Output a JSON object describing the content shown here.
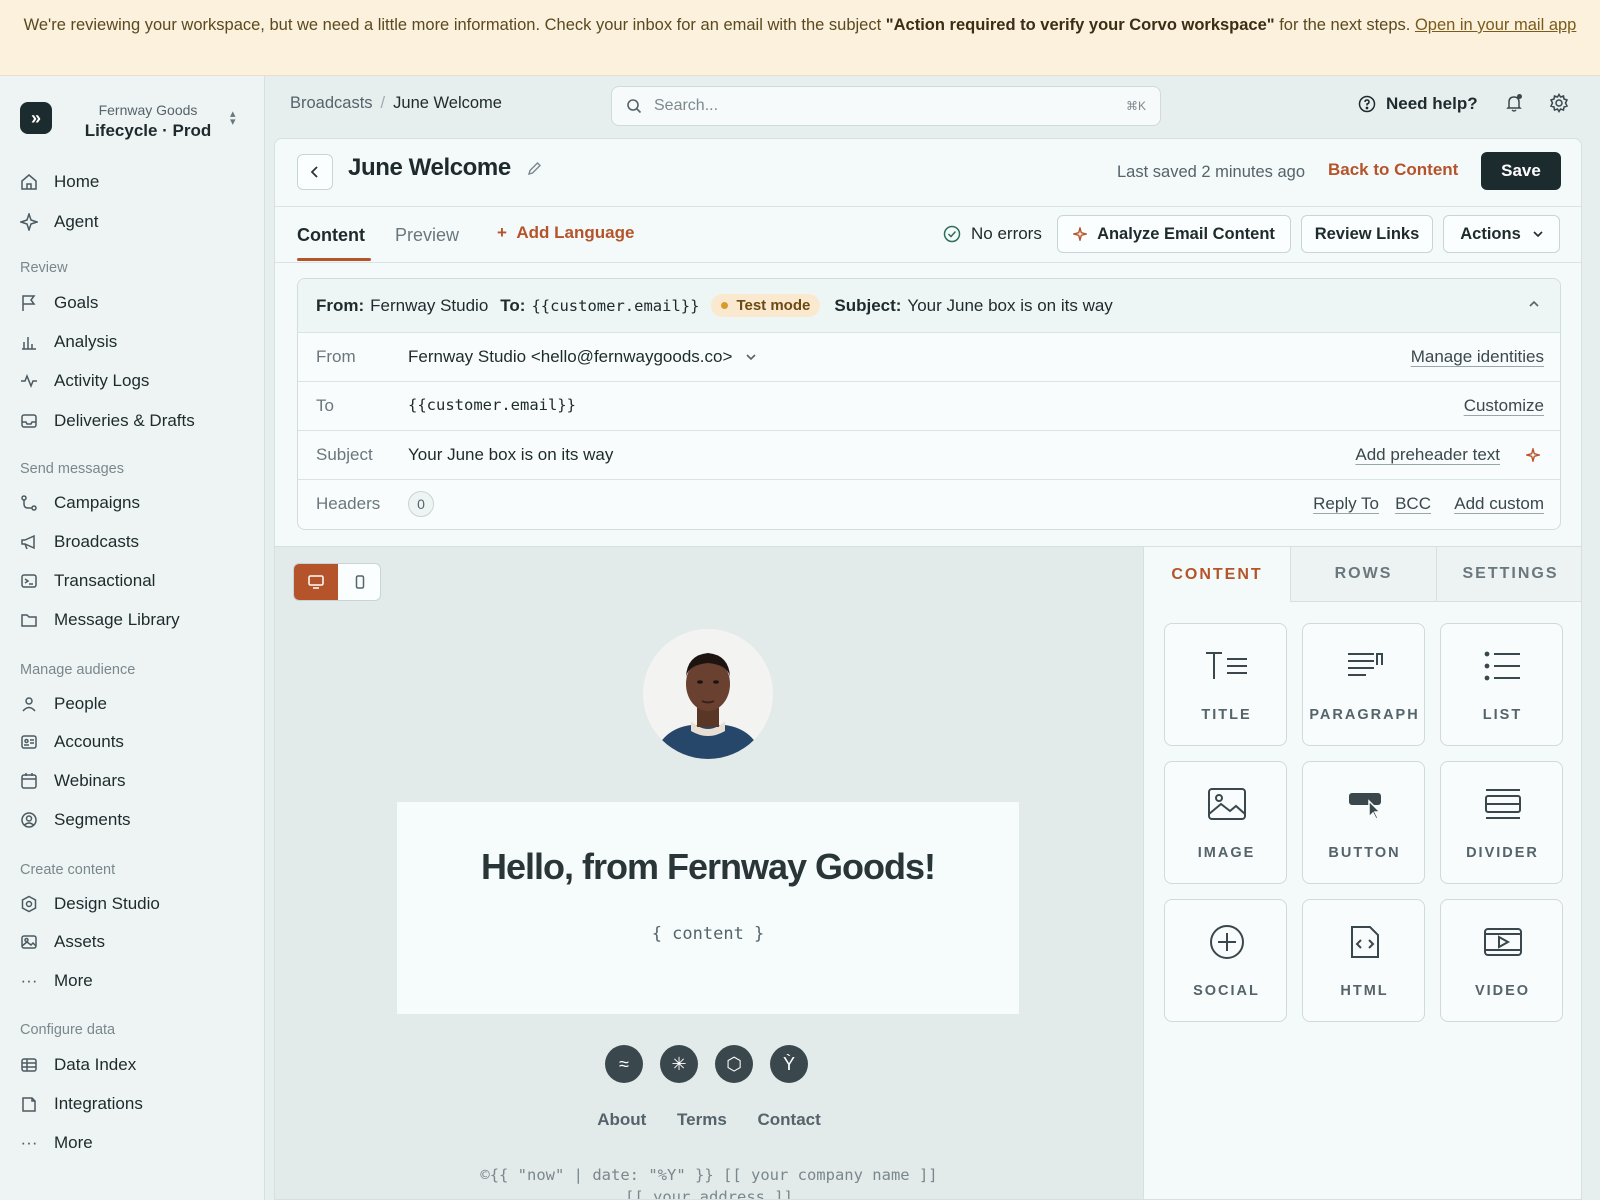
{
  "banner": {
    "text_pre": "We're reviewing your workspace, but we need a little more information. Check your inbox for an email with the subject ",
    "subject": "\"Action required to verify your Corvo workspace\"",
    "text_post": " for the next steps. ",
    "link": "Open in your mail app"
  },
  "workspace": {
    "org": "Fernway Goods",
    "name": "Lifecycle · Prod"
  },
  "sidebar": {
    "top": [
      {
        "label": "Home"
      },
      {
        "label": "Agent"
      }
    ],
    "sections": [
      {
        "title": "Review",
        "items": [
          "Goals",
          "Analysis",
          "Activity Logs",
          "Deliveries & Drafts"
        ]
      },
      {
        "title": "Send messages",
        "items": [
          "Campaigns",
          "Broadcasts",
          "Transactional",
          "Message Library"
        ]
      },
      {
        "title": "Manage audience",
        "items": [
          "People",
          "Accounts",
          "Webinars",
          "Segments"
        ]
      },
      {
        "title": "Create content",
        "items": [
          "Design Studio",
          "Assets",
          "More"
        ]
      },
      {
        "title": "Configure data",
        "items": [
          "Data Index",
          "Integrations",
          "More"
        ]
      }
    ]
  },
  "topbar": {
    "breadcrumb": [
      "Broadcasts",
      "June Welcome"
    ],
    "search_placeholder": "Search...",
    "search_shortcut": "⌘K",
    "help": "Need help?"
  },
  "editor": {
    "title": "June Welcome",
    "last_saved": "Last saved 2 minutes ago",
    "back_to_content": "Back to Content",
    "save": "Save",
    "tabs": [
      "Content",
      "Preview"
    ],
    "add_language": "Add Language",
    "status": "No errors",
    "buttons": {
      "analyze": "Analyze Email Content",
      "review_links": "Review Links",
      "actions": "Actions"
    }
  },
  "summary": {
    "from_label": "From:",
    "from_value": "Fernway Studio",
    "to_label": "To:",
    "to_value": "{{customer.email}}",
    "test_mode": "Test mode",
    "subject_label": "Subject:",
    "subject_value": "Your June box is on its way"
  },
  "fields": {
    "from": {
      "label": "From",
      "value": "Fernway Studio <hello@fernwaygoods.co>",
      "action": "Manage identities"
    },
    "to": {
      "label": "To",
      "value": "{{customer.email}}",
      "action": "Customize"
    },
    "subject": {
      "label": "Subject",
      "value": "Your June box is on its way",
      "action": "Add preheader text"
    },
    "headers": {
      "label": "Headers",
      "count": "0",
      "actions": [
        "Reply To",
        "BCC",
        "Add custom"
      ]
    }
  },
  "email": {
    "heading": "Hello, from Fernway Goods!",
    "content": "{ content }",
    "footer_links": [
      "About",
      "Terms",
      "Contact"
    ],
    "copyright": "©{{ \"now\" | date: \"%Y\" }} [[ your company name ]]",
    "address": "[[ your address ]]"
  },
  "panel": {
    "tabs": [
      "CONTENT",
      "ROWS",
      "SETTINGS"
    ],
    "blocks": [
      "TITLE",
      "PARAGRAPH",
      "LIST",
      "IMAGE",
      "BUTTON",
      "DIVIDER",
      "SOCIAL",
      "HTML",
      "VIDEO"
    ]
  },
  "colors": {
    "accent": "#b5532a",
    "dark": "#1c2b2e",
    "banner": "#fbf1dd"
  }
}
